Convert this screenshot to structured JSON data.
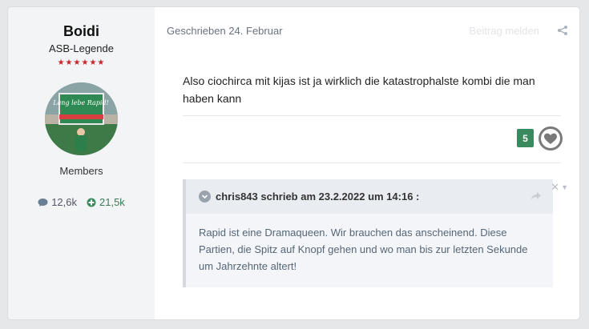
{
  "author": {
    "name": "Boidi",
    "rank": "ASB-Legende",
    "stars": "★★★★★★",
    "avatar_text": "Lang lebe Rapid!",
    "group": "Members",
    "posts": "12,6k",
    "reputation": "21,5k"
  },
  "post": {
    "meta": "Geschrieben 24. Februar",
    "report": "Beitrag melden",
    "content": "Also ciochirca mit kijas ist ja wirklich die katastrophalste kombi die man haben kann",
    "reaction_count": "5",
    "quote": {
      "author": "chris843 schrieb am 23.2.2022 um 14:16 :",
      "text": "Rapid ist eine Dramaqueen. Wir brauchen das anscheinend. Diese Partien, die Spitz auf Knopf gehen und wo man bis zur letzten Sekunde um Jahrzehnte altert!"
    }
  },
  "colors": {
    "rep_badge": "#3b8a5f",
    "stars": "#c8262b"
  }
}
